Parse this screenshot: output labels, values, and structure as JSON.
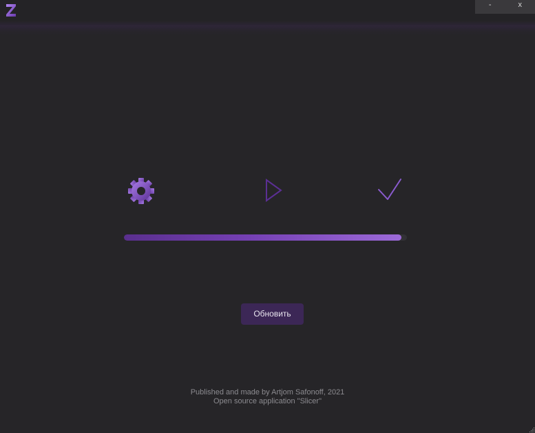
{
  "titlebar": {
    "logo_icon": "slicer-logo-icon",
    "minimize_label": "-",
    "close_label": "x"
  },
  "steps": [
    {
      "icon": "gear-icon",
      "state": "active"
    },
    {
      "icon": "play-icon",
      "state": "pending"
    },
    {
      "icon": "check-icon",
      "state": "pending"
    }
  ],
  "progress": {
    "value_percent": 98
  },
  "actions": {
    "update_label": "Обновить"
  },
  "footer": {
    "line1": "Published and made by Artjom Safonoff, 2021",
    "line2": "Open source application \"Slicer\""
  },
  "colors": {
    "background": "#262528",
    "accent": "#7540b4",
    "accent_light": "#9c6ad8",
    "button_bg": "#3c2756"
  }
}
